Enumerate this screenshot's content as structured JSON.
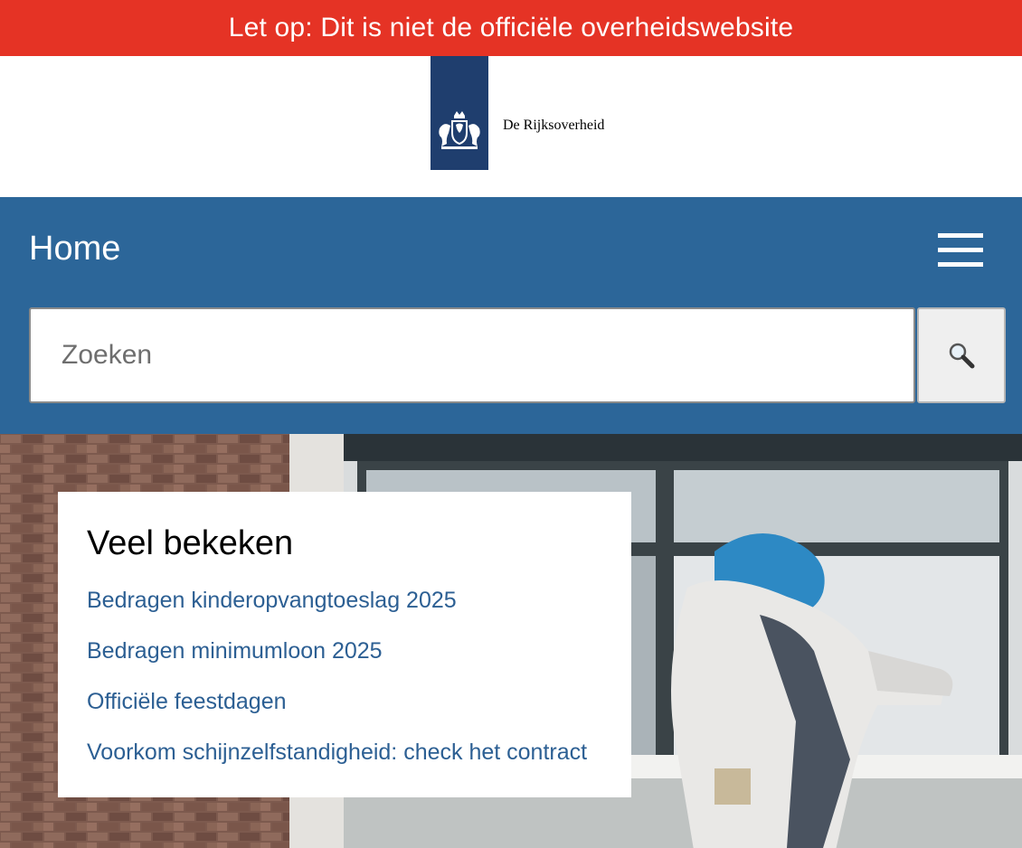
{
  "warning": {
    "text": "Let op: Dit is niet de officiële overheidswebsite"
  },
  "logo": {
    "text": "De Rijksoverheid",
    "icon": "coat-of-arms-icon",
    "bar_color": "#1f3e6e"
  },
  "header": {
    "title": "Home",
    "menu_icon": "hamburger-menu-icon"
  },
  "search": {
    "placeholder": "Zoeken",
    "value": "",
    "button_icon": "magnifier-icon"
  },
  "popular": {
    "title": "Veel bekeken",
    "links": [
      "Bedragen kinderopvangtoeslag 2025",
      "Bedragen minimumloon 2025",
      "Officiële feestdagen",
      "Voorkom schijnzelfstandigheid: check het contract"
    ]
  },
  "colors": {
    "warning_red": "#e53325",
    "header_blue": "#2c6699",
    "link_blue": "#2c5f93"
  }
}
